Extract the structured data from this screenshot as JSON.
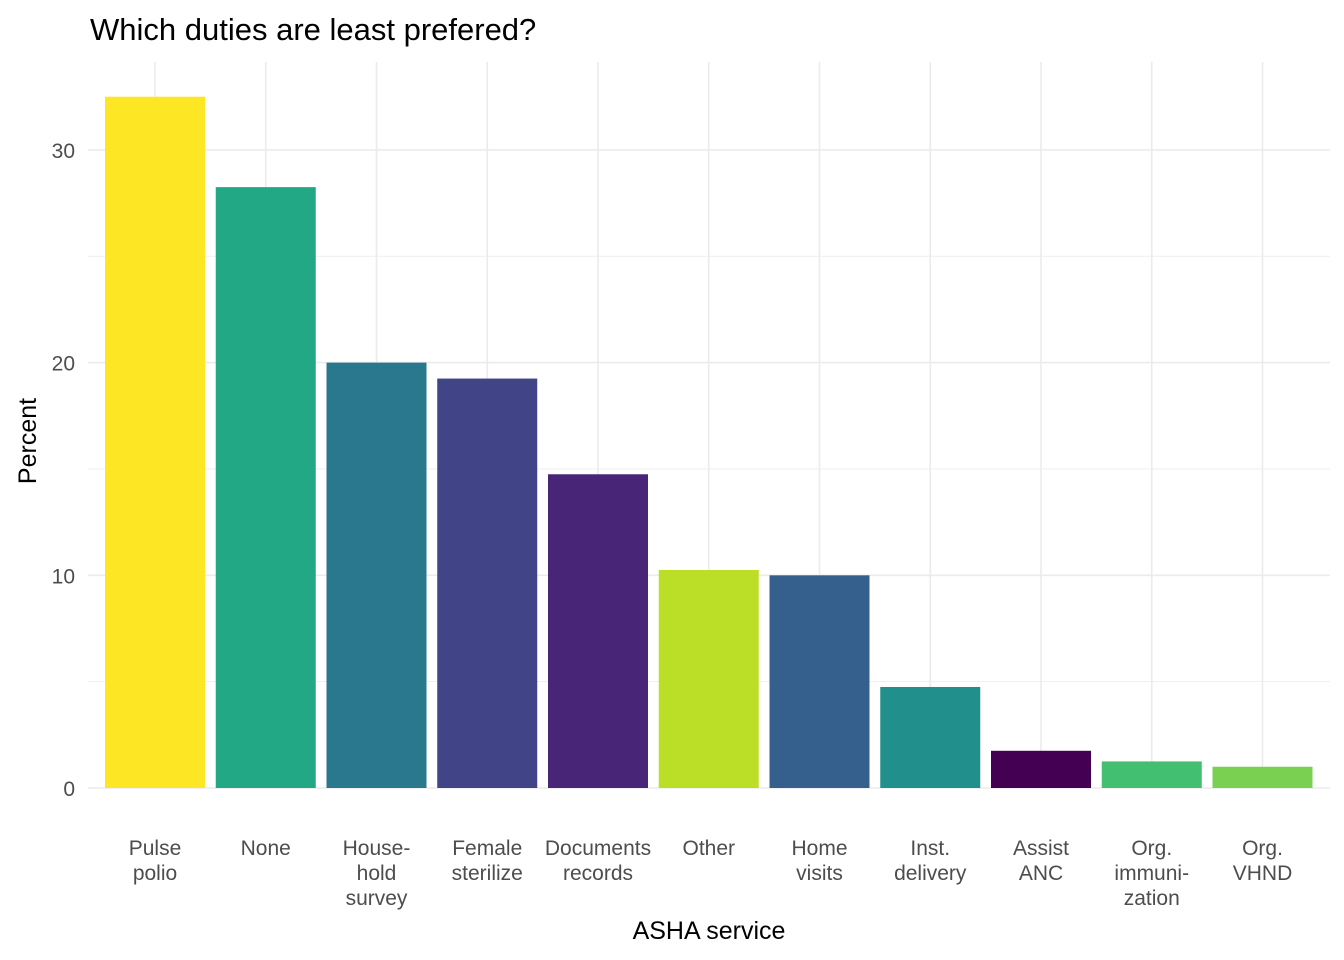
{
  "chart_data": {
    "type": "bar",
    "title": "Which duties are least prefered?",
    "xlabel": "ASHA service",
    "ylabel": "Percent",
    "ylim": [
      0,
      33.5
    ],
    "yticks": [
      0,
      10,
      20,
      30
    ],
    "ytick_labels": [
      "0",
      "10",
      "20",
      "30"
    ],
    "grid": true,
    "legend": "none",
    "categories": [
      [
        "Pulse",
        "polio"
      ],
      [
        "None"
      ],
      [
        "House-",
        "hold",
        "survey"
      ],
      [
        "Female",
        "sterilize"
      ],
      [
        "Documents",
        "records"
      ],
      [
        "Other"
      ],
      [
        "Home",
        "visits"
      ],
      [
        "Inst.",
        "delivery"
      ],
      [
        "Assist",
        "ANC"
      ],
      [
        "Org.",
        "immuni-",
        "zation"
      ],
      [
        "Org.",
        "VHND"
      ]
    ],
    "values": [
      32.5,
      28.25,
      20.0,
      19.25,
      14.75,
      10.25,
      10.0,
      4.75,
      1.75,
      1.25,
      1.0
    ],
    "colors": [
      "#FDE725",
      "#22A884",
      "#2A788E",
      "#414487",
      "#482576",
      "#BBDF27",
      "#35608D",
      "#21908C",
      "#440154",
      "#43BF71",
      "#7AD151"
    ]
  }
}
